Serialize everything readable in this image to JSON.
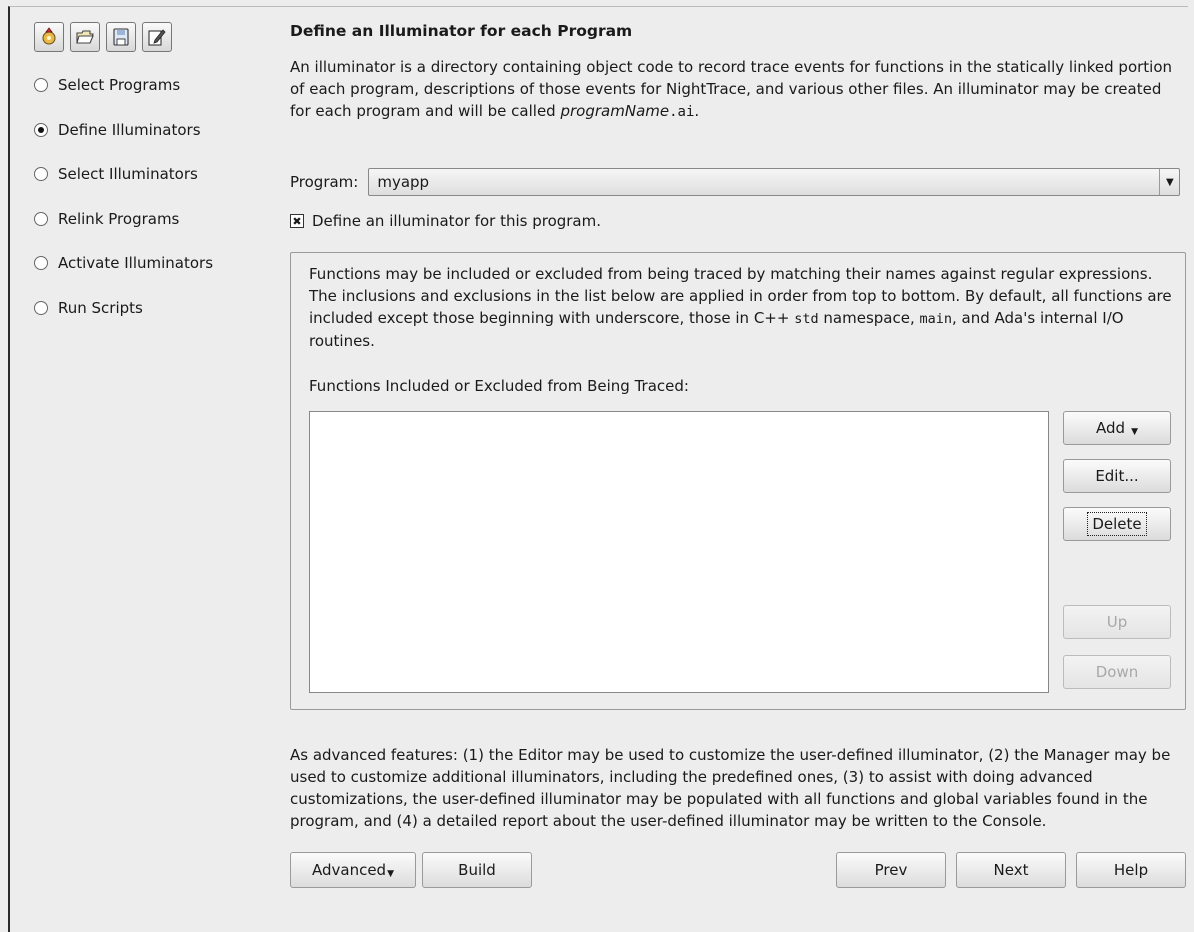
{
  "toolbar": {
    "icons": [
      "new-icon",
      "open-folder-icon",
      "save-icon",
      "edit-icon"
    ]
  },
  "steps": [
    {
      "label": "Select Programs",
      "selected": false
    },
    {
      "label": "Define Illuminators",
      "selected": true
    },
    {
      "label": "Select Illuminators",
      "selected": false
    },
    {
      "label": "Relink Programs",
      "selected": false
    },
    {
      "label": "Activate Illuminators",
      "selected": false
    },
    {
      "label": "Run Scripts",
      "selected": false
    }
  ],
  "page": {
    "title": "Define an Illuminator for each Program",
    "intro_text": "An illuminator is a directory containing object code to record trace events for functions in the statically linked portion of each program, descriptions of those events for NightTrace, and various other files. An illuminator may be created for each program and will be called",
    "intro_name_italic": "programName",
    "intro_name_ext": ".ai",
    "intro_end": "."
  },
  "program": {
    "label": "Program:",
    "value": "myapp"
  },
  "define_checkbox": {
    "label": "Define an illuminator for this program.",
    "checked": true
  },
  "functions": {
    "desc_1": "Functions may be included or excluded from being traced by matching their names against regular expressions. The inclusions and exclusions in the list below are applied in order from top to bottom. By default, all functions are included except those beginning with underscore, those in C++",
    "desc_std": "std",
    "desc_2": "namespace,",
    "desc_main": "main",
    "desc_3": ", and Ada's internal I/O routines.",
    "list_label": "Functions Included or Excluded from Being Traced:",
    "items": [],
    "buttons": {
      "add": "Add",
      "edit": "Edit...",
      "delete": "Delete",
      "up": "Up",
      "down": "Down"
    }
  },
  "advanced_text": "As advanced features: (1) the Editor may be used to customize the user-defined illuminator, (2) the Manager may be used to customize additional illuminators, including the predefined ones, (3) to assist with doing advanced customizations, the user-defined illuminator may be populated with all functions and global variables found in the program, and (4) a detailed report about the user-defined illuminator may be written to the Console.",
  "footer": {
    "advanced": "Advanced",
    "build": "Build",
    "prev": "Prev",
    "next": "Next",
    "help": "Help"
  }
}
